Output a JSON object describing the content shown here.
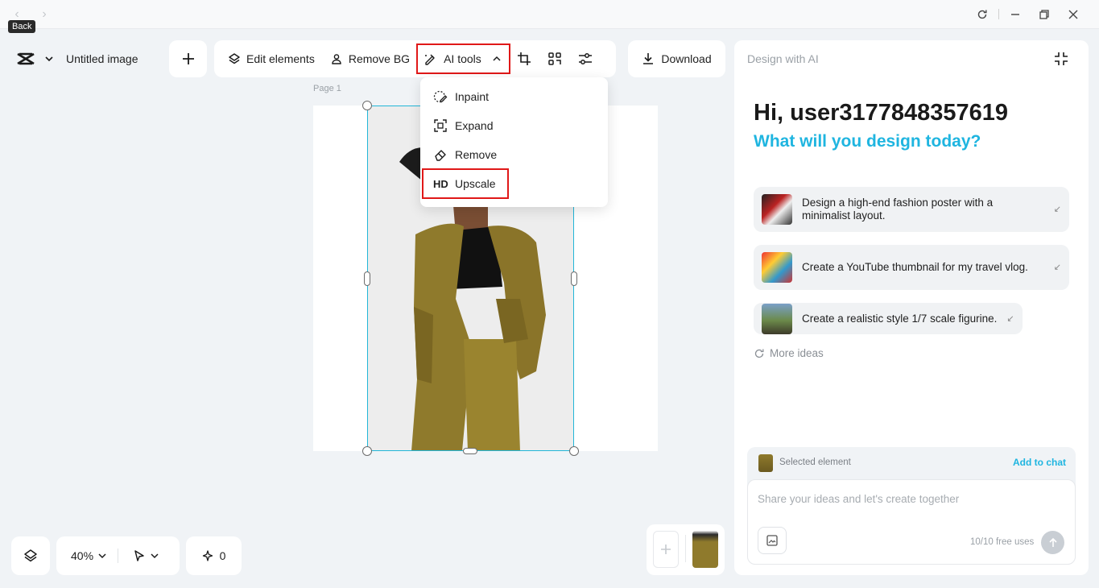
{
  "window": {
    "back_tooltip": "Back"
  },
  "header": {
    "doc_title": "Untitled image"
  },
  "toolbar": {
    "edit_elements": "Edit elements",
    "remove_bg": "Remove BG",
    "ai_tools": "AI tools",
    "download": "Download"
  },
  "ai_menu": {
    "items": [
      {
        "label": "Inpaint",
        "icon": "brush-dotted-icon"
      },
      {
        "label": "Expand",
        "icon": "expand-frame-icon"
      },
      {
        "label": "Remove",
        "icon": "eraser-icon"
      },
      {
        "label": "Upscale",
        "icon": "HD"
      }
    ]
  },
  "canvas": {
    "page_label": "Page 1"
  },
  "ai_panel": {
    "title": "Design with AI",
    "greeting": "Hi, user3177848357619",
    "subtitle": "What will you design today?",
    "suggestions": [
      {
        "text": "Design a high-end fashion poster with a minimalist layout."
      },
      {
        "text": "Create a YouTube thumbnail for my travel vlog."
      },
      {
        "text": "Create a realistic style 1/7 scale figurine."
      }
    ],
    "more_ideas": "More ideas",
    "selected_element": "Selected element",
    "add_to_chat": "Add to chat",
    "input_placeholder": "Share your ideas and let's create together",
    "free_uses": "10/10 free uses"
  },
  "bottom_bar": {
    "zoom": "40%",
    "ai_count": "0"
  },
  "colors": {
    "accent": "#1fb5e0",
    "highlight": "#e01818",
    "selection": "#22b6d8"
  }
}
